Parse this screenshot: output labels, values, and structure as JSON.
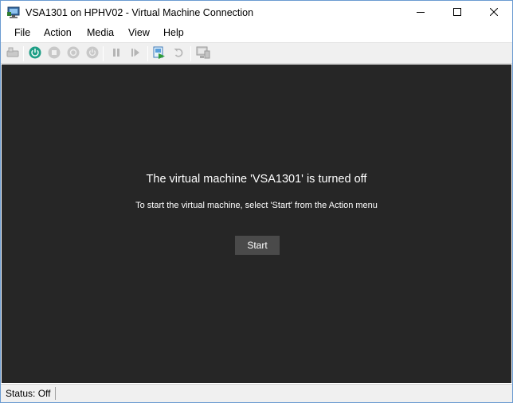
{
  "window": {
    "title": "VSA1301 on HPHV02 - Virtual Machine Connection"
  },
  "menu": {
    "items": [
      {
        "label": "File"
      },
      {
        "label": "Action"
      },
      {
        "label": "Media"
      },
      {
        "label": "View"
      },
      {
        "label": "Help"
      }
    ]
  },
  "toolbar": {
    "buttons": [
      {
        "icon": "ctrl-alt-del-icon"
      },
      {
        "icon": "start-icon"
      },
      {
        "icon": "turn-off-icon"
      },
      {
        "icon": "shut-down-icon"
      },
      {
        "icon": "save-icon"
      },
      {
        "icon": "pause-icon"
      },
      {
        "icon": "resume-icon"
      },
      {
        "icon": "checkpoint-icon"
      },
      {
        "icon": "revert-icon"
      },
      {
        "icon": "enhanced-session-icon"
      }
    ]
  },
  "screen": {
    "message_title": "The virtual machine 'VSA1301' is turned off",
    "message_sub": "To start the virtual machine, select 'Start' from the Action menu",
    "start_label": "Start",
    "background": "#262626"
  },
  "status": {
    "text": "Status: Off"
  },
  "colors": {
    "start_green": "#1e9e86",
    "screen_bg": "#262626",
    "button_bg": "#4a4a4a"
  }
}
